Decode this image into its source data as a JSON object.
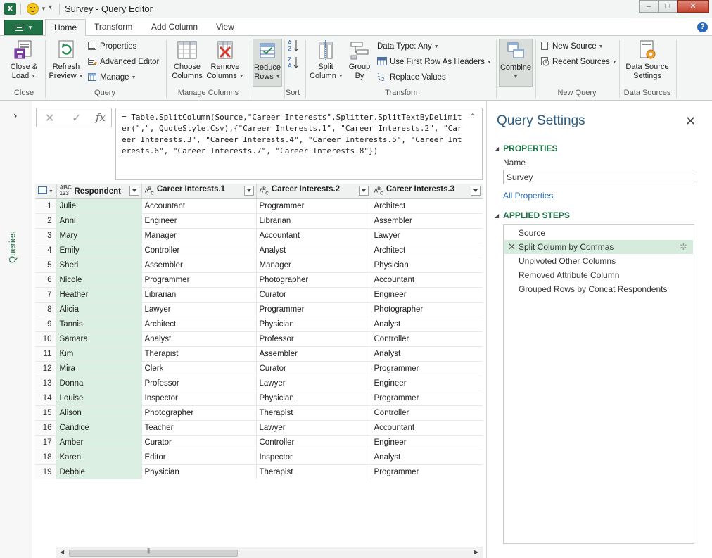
{
  "window": {
    "title": "Survey - Query Editor"
  },
  "ribbon_tabs": [
    "Home",
    "Transform",
    "Add Column",
    "View"
  ],
  "ribbon": {
    "close": {
      "label1": "Close &",
      "label2": "Load",
      "group": "Close"
    },
    "query": {
      "refresh1": "Refresh",
      "refresh2": "Preview",
      "properties": "Properties",
      "advanced_editor": "Advanced Editor",
      "manage": "Manage",
      "group": "Query"
    },
    "manage_columns": {
      "choose1": "Choose",
      "choose2": "Columns",
      "remove1": "Remove",
      "remove2": "Columns",
      "group": "Manage Columns"
    },
    "reduce": {
      "label1": "Reduce",
      "label2": "Rows"
    },
    "sort": {
      "group": "Sort"
    },
    "transform": {
      "split1": "Split",
      "split2": "Column",
      "group1": "Group",
      "group2": "By",
      "data_type": "Data Type: Any",
      "first_row": "Use First Row As Headers",
      "replace": "Replace Values",
      "group": "Transform"
    },
    "combine": {
      "label": "Combine"
    },
    "new_query": {
      "new_source": "New Source",
      "recent_sources": "Recent Sources",
      "group": "New Query"
    },
    "data_sources": {
      "label1": "Data Source",
      "label2": "Settings",
      "group": "Data Sources"
    }
  },
  "queries_pane": {
    "label": "Queries"
  },
  "formula_bar": {
    "cancel": "✕",
    "confirm": "✓",
    "fx": "fx",
    "formula": "= Table.SplitColumn(Source,\"Career Interests\",Splitter.SplitTextByDelimiter(\",\", QuoteStyle.Csv),{\"Career Interests.1\", \"Career Interests.2\", \"Career Interests.3\", \"Career Interests.4\", \"Career Interests.5\", \"Career Interests.6\", \"Career Interests.7\", \"Career Interests.8\"})"
  },
  "grid": {
    "columns": [
      {
        "type": "ABC\n123",
        "name": "Respondent"
      },
      {
        "type": "ABC",
        "name": "Career Interests.1"
      },
      {
        "type": "ABC",
        "name": "Career Interests.2"
      },
      {
        "type": "ABC",
        "name": "Career Interests.3"
      }
    ],
    "rows": [
      [
        "1",
        "Julie",
        "Accountant",
        "Programmer",
        "Architect"
      ],
      [
        "2",
        "Anni",
        "Engineer",
        "Librarian",
        "Assembler"
      ],
      [
        "3",
        "Mary",
        "Manager",
        "Accountant",
        "Lawyer"
      ],
      [
        "4",
        "Emily",
        "Controller",
        "Analyst",
        "Architect"
      ],
      [
        "5",
        "Sheri",
        "Assembler",
        "Manager",
        "Physician"
      ],
      [
        "6",
        "Nicole",
        "Programmer",
        "Photographer",
        "Accountant"
      ],
      [
        "7",
        "Heather",
        "Librarian",
        "Curator",
        "Engineer"
      ],
      [
        "8",
        "Alicia",
        "Lawyer",
        "Programmer",
        "Photographer"
      ],
      [
        "9",
        "Tannis",
        "Architect",
        "Physician",
        "Analyst"
      ],
      [
        "10",
        "Samara",
        "Analyst",
        "Professor",
        "Controller"
      ],
      [
        "11",
        "Kim",
        "Therapist",
        "Assembler",
        "Analyst"
      ],
      [
        "12",
        "Mira",
        "Clerk",
        "Curator",
        "Programmer"
      ],
      [
        "13",
        "Donna",
        "Professor",
        "Lawyer",
        "Engineer"
      ],
      [
        "14",
        "Louise",
        "Inspector",
        "Physician",
        "Programmer"
      ],
      [
        "15",
        "Alison",
        "Photographer",
        "Therapist",
        "Controller"
      ],
      [
        "16",
        "Candice",
        "Teacher",
        "Lawyer",
        "Accountant"
      ],
      [
        "17",
        "Amber",
        "Curator",
        "Controller",
        "Engineer"
      ],
      [
        "18",
        "Karen",
        "Editor",
        "Inspector",
        "Analyst"
      ],
      [
        "19",
        "Debbie",
        "Physician",
        "Therapist",
        "Programmer"
      ]
    ]
  },
  "query_settings": {
    "title": "Query Settings",
    "properties_header": "PROPERTIES",
    "name_label": "Name",
    "name_value": "Survey",
    "all_properties": "All Properties",
    "applied_steps_header": "APPLIED STEPS",
    "steps": [
      "Source",
      "Split Column by Commas",
      "Unpivoted Other Columns",
      "Removed Attribute Column",
      "Grouped Rows by Concat Respondents"
    ],
    "selected_step": "Split Column by Commas"
  },
  "colors": {
    "excel_green": "#217346",
    "accent_text": "#1e7145",
    "selected_row": "#d5ecdd",
    "respondent_col": "#dcefe3"
  }
}
